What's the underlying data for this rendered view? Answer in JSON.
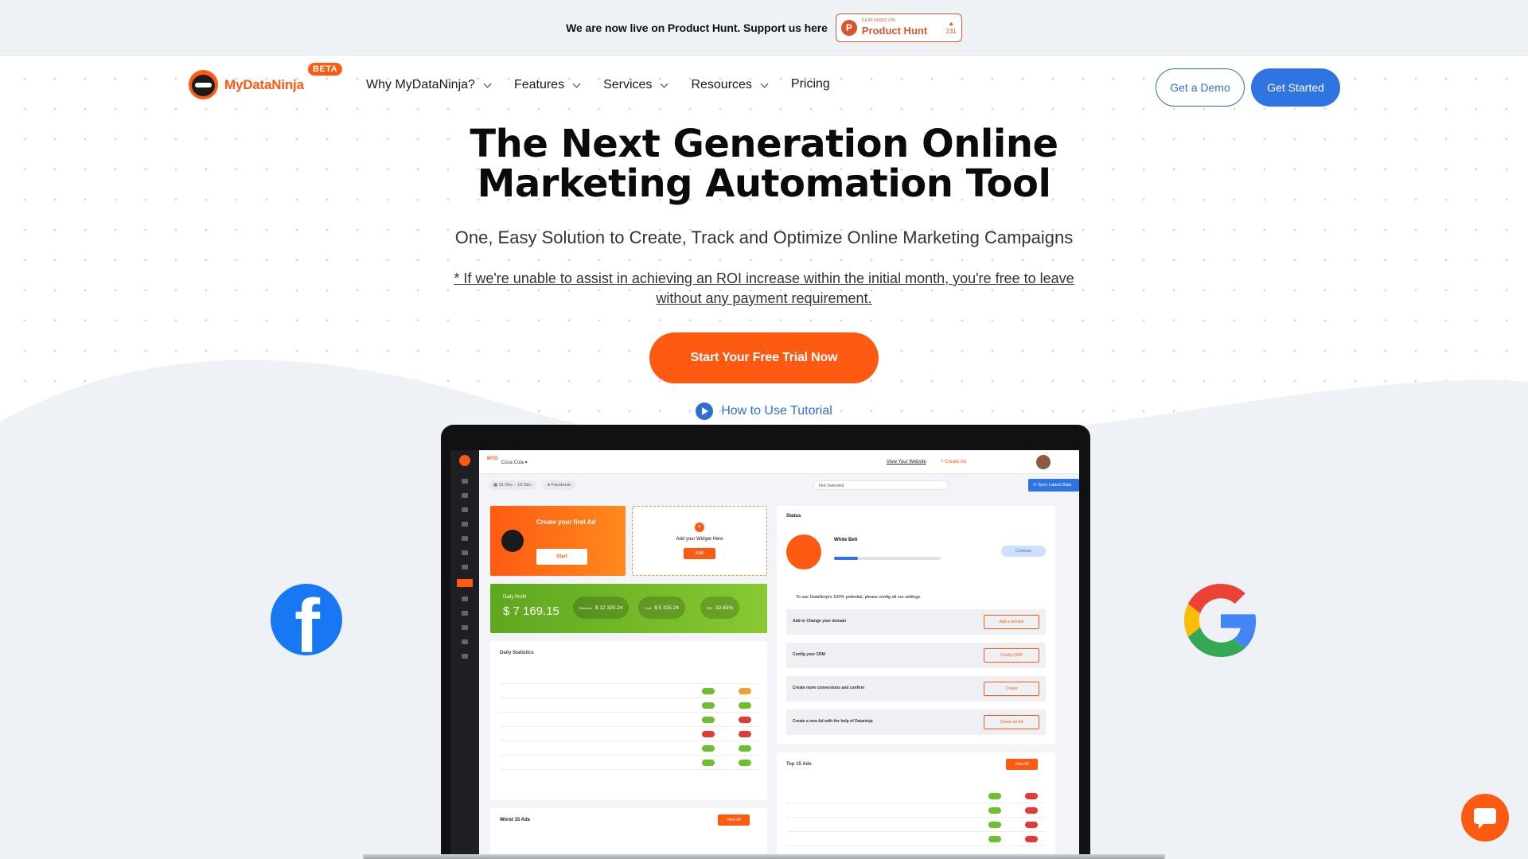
{
  "announcement": {
    "text": "We are now live on Product Hunt. Support us here",
    "badge_small": "FEATURED ON",
    "badge_name": "Product Hunt",
    "badge_votes": "231"
  },
  "nav": {
    "logo_text": "MyDataNinja",
    "beta": "BETA",
    "menu": [
      {
        "label": "Why MyDataNinja?",
        "dropdown": true
      },
      {
        "label": "Features",
        "dropdown": true
      },
      {
        "label": "Services",
        "dropdown": true
      },
      {
        "label": "Resources",
        "dropdown": true
      },
      {
        "label": "Pricing",
        "dropdown": false
      }
    ],
    "demo_button": "Get a Demo",
    "start_button": "Get Started"
  },
  "hero": {
    "title": "The Next Generation Online Marketing Automation Tool",
    "subtitle": "One, Easy Solution to Create, Track and Optimize Online Marketing Campaigns",
    "note": "* If we're unable to assist in achieving an ROI increase within the initial month, you're free to leave without any payment requirement.",
    "cta": "Start Your Free Trial Now",
    "tutorial": "How to Use Tutorial"
  },
  "colors": {
    "accent_orange": "#ff5a12",
    "primary_blue": "#2f74e0",
    "facebook_blue": "#1877f2"
  },
  "dashboard": {
    "top": {
      "view_site": "View Your Website",
      "create_ad": "+ Create Ad"
    },
    "create_card": {
      "title": "Create your first Ad",
      "button": "Start"
    },
    "widget_card": {
      "title": "Add your Widget Here",
      "button": "Add"
    },
    "profit": {
      "label": "Daily Profit",
      "value": "$ 7 169.15",
      "pills": [
        {
          "label": "Revenue",
          "value": "$ 12 325.24"
        },
        {
          "label": "Cost",
          "value": "$ 5 325.24"
        },
        {
          "label": "ROI",
          "value": "32.45%"
        }
      ]
    },
    "daily_stats_title": "Daily Statistics",
    "status_title": "Status",
    "belt": "White Belt",
    "continue": "Continue",
    "setup_hint": "To use DataNinja's 100% potential, please config all our settings.",
    "setup_rows": [
      {
        "label": "Add or Change your domain",
        "button": "Add a domain"
      },
      {
        "label": "Config your CRM",
        "button": "Config CRM"
      },
      {
        "label": "Create more conversions and confirm",
        "button": "Create"
      },
      {
        "label": "Create a new Ad with the help of Dataninja",
        "button": "Create an Ad"
      }
    ],
    "top_ads_title": "Top 15 Ads",
    "worst_ads_title": "Worst 15 Ads",
    "view_all": "View All"
  }
}
